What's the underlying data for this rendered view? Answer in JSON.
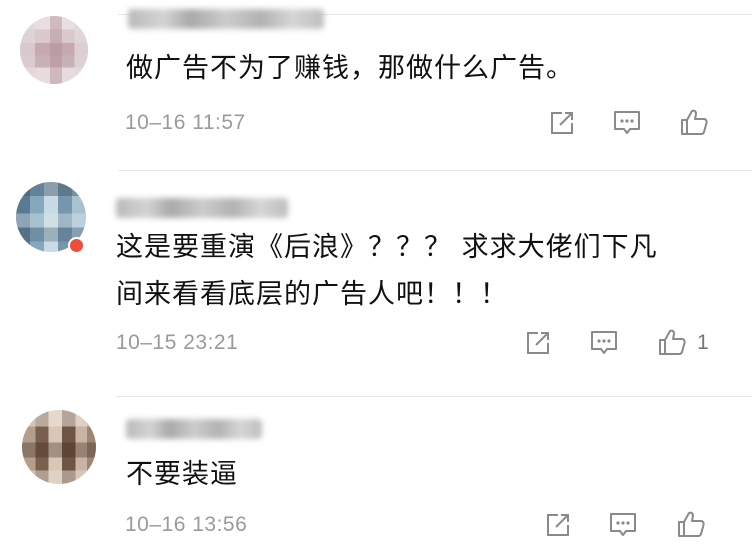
{
  "comments": [
    {
      "text": "做广告不为了赚钱，那做什么广告。",
      "time": "10–16 11:57",
      "likes": ""
    },
    {
      "text_line1": "这是要重演《后浪》？？？ 求求大佬们下凡",
      "text_line2": "间来看看底层的广告人吧！！！",
      "time": "10–15 23:21",
      "likes": "1"
    },
    {
      "text": "不要装逼",
      "time": "10–16 13:56",
      "likes": ""
    }
  ],
  "icons": {
    "share": "share-icon",
    "comment": "comment-icon",
    "like": "like-icon"
  },
  "colors": {
    "text": "#111111",
    "muted": "#9a9a9a",
    "icon": "#8a8a8a",
    "divider": "#e7e7e7",
    "badge": "#f04c3b"
  }
}
